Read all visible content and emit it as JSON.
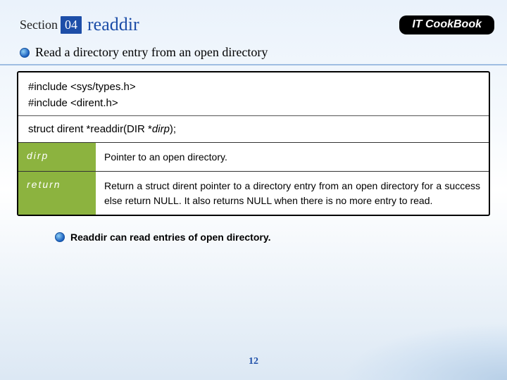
{
  "header": {
    "section_label": "Section",
    "section_number": "04",
    "title": "readdir",
    "brand": "IT CookBook"
  },
  "intro": "Read a directory entry from an open directory",
  "code": {
    "include1": "#include <sys/types.h>",
    "include2": "#include <dirent.h>",
    "sig_prefix": "struct dirent *readdir(DIR *",
    "sig_param": "dirp",
    "sig_suffix": ");"
  },
  "params": {
    "row1_key": "dirp",
    "row1_desc": "Pointer to an open directory.",
    "row2_key": "return",
    "row2_desc": "Return a struct dirent pointer to a directory entry from an open directory for a success else return NULL. It also returns NULL when there is no more entry to read."
  },
  "note": "Readdir can read entries of open directory.",
  "page_number": "12"
}
